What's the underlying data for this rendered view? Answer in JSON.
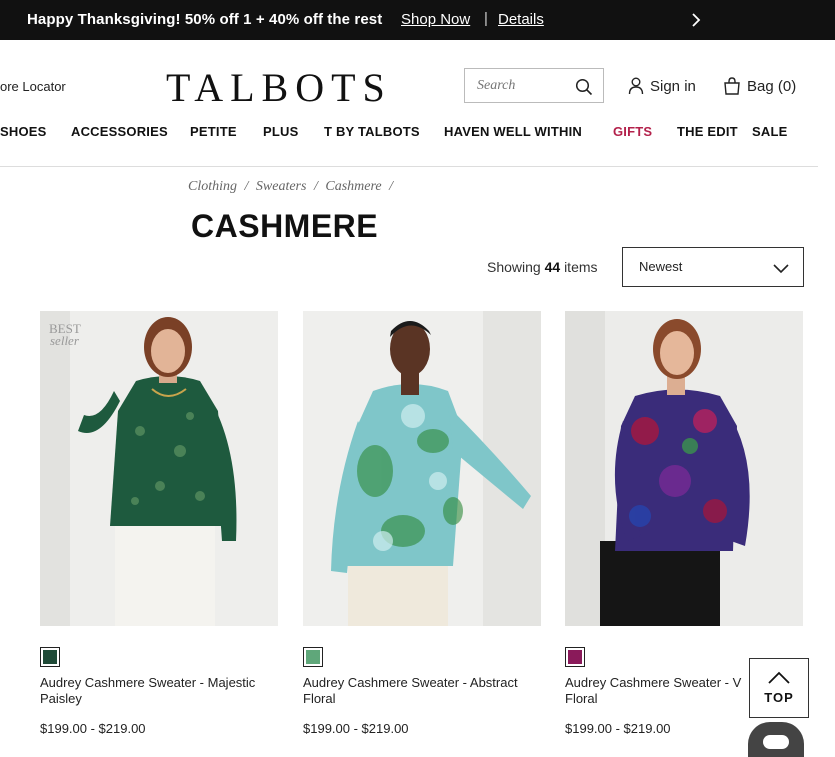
{
  "promo": {
    "text": "Happy Thanksgiving! 50% off 1 + 40% off the rest",
    "shop_now": "Shop Now",
    "separator": "|",
    "details": "Details"
  },
  "header": {
    "store_locator": "ore Locator",
    "logo": "TALBOTS",
    "search_placeholder": "Search",
    "sign_in": "Sign in",
    "bag": "Bag (0)"
  },
  "nav": {
    "items": [
      "SHOES",
      "ACCESSORIES",
      "PETITE",
      "PLUS",
      "T BY TALBOTS",
      "HAVEN WELL WITHIN",
      "GIFTS",
      "THE EDIT",
      "SALE"
    ]
  },
  "breadcrumb": [
    "Clothing",
    "/",
    "Sweaters",
    "/",
    "Cashmere",
    "/"
  ],
  "page_title": "CASHMERE",
  "results": {
    "prefix": "Showing",
    "count": "44",
    "suffix": "items",
    "sort_selected": "Newest"
  },
  "products": [
    {
      "name": "Audrey Cashmere Sweater - Majestic Paisley",
      "price": "$199.00 - $219.00",
      "badge_line1": "BEST",
      "badge_line2": "seller",
      "swatch_color": "#1f4a37",
      "sweater_color": "#1e5a3e",
      "pants_color": "#f4f3ef"
    },
    {
      "name": "Audrey Cashmere Sweater - Abstract Floral",
      "price": "$199.00 - $219.00",
      "swatch_color": "#5fa77a",
      "sweater_color": "#7fc6c9",
      "pants_color": "#efe9dc"
    },
    {
      "name": "Audrey Cashmere Sweater - V",
      "name_line2": "Floral",
      "price": "$199.00 - $219.00",
      "swatch_color": "#8a1a5a",
      "sweater_color": "#3a2c7a",
      "pants_color": "#151515"
    }
  ],
  "back_to_top": "TOP",
  "colors": {
    "promo_bg": "#111111",
    "gifts": "#b3214b",
    "chat_bg": "#444444"
  }
}
